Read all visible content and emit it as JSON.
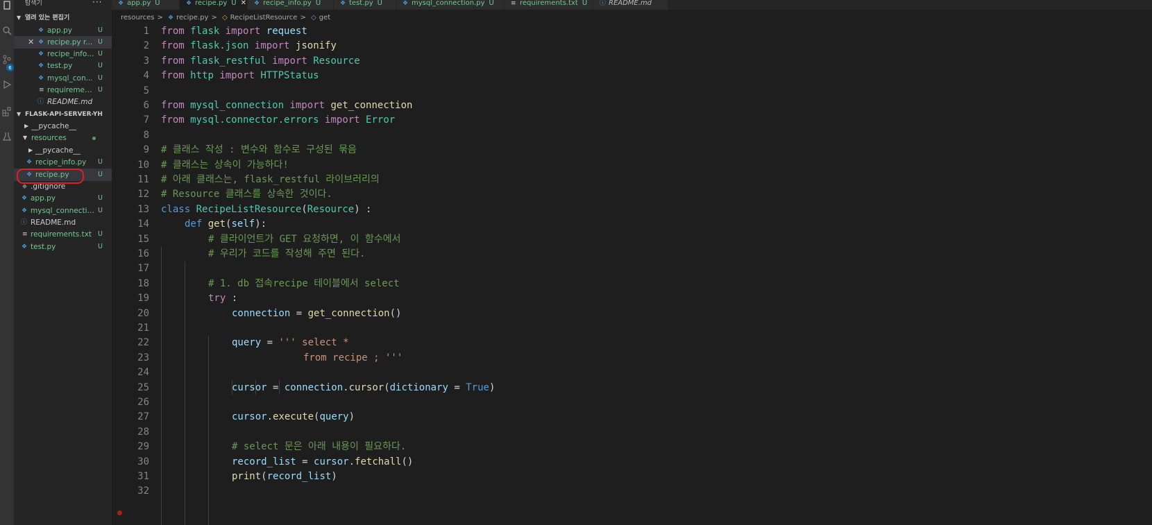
{
  "sidebar": {
    "title": "탐색기",
    "more": "···",
    "open_editors": {
      "header": "열려 있는 편집기",
      "items": [
        {
          "label": "app.py",
          "badge": "U"
        },
        {
          "label": "recipe.py r...",
          "badge": "U",
          "close": "✕"
        },
        {
          "label": "recipe_info....",
          "badge": "U"
        },
        {
          "label": "test.py",
          "badge": "U"
        },
        {
          "label": "mysql_con...",
          "badge": "U"
        },
        {
          "label": "requiremen...",
          "badge": "U"
        },
        {
          "label": "README.md",
          "badge": ""
        }
      ]
    },
    "workspace": {
      "header": "FLASK-API-SERVER-YH",
      "items": [
        {
          "label": "__pycache__",
          "badge": ""
        },
        {
          "label": "resources",
          "badge": ""
        },
        {
          "label": "__pycache__",
          "badge": ""
        },
        {
          "label": "recipe_info.py",
          "badge": "U"
        },
        {
          "label": "recipe.py",
          "badge": "U"
        },
        {
          "label": ".gitignore",
          "badge": ""
        },
        {
          "label": "app.py",
          "badge": "U"
        },
        {
          "label": "mysql_connectio...",
          "badge": "U"
        },
        {
          "label": "README.md",
          "badge": ""
        },
        {
          "label": "requirements.txt",
          "badge": "U"
        },
        {
          "label": "test.py",
          "badge": "U"
        }
      ]
    }
  },
  "activity": {
    "scm_badge": "6"
  },
  "tabs": [
    {
      "label": "app.py",
      "badge": "U"
    },
    {
      "label": "recipe.py",
      "badge": "U",
      "close": "✕"
    },
    {
      "label": "recipe_info.py",
      "badge": "U"
    },
    {
      "label": "test.py",
      "badge": "U"
    },
    {
      "label": "mysql_connection.py",
      "badge": "U"
    },
    {
      "label": "requirements.txt",
      "badge": "U"
    },
    {
      "label": "README.md",
      "badge": ""
    }
  ],
  "breadcrumb": {
    "folder": "resources",
    "file": "recipe.py",
    "class": "RecipeListResource",
    "method": "get",
    "sep": ">"
  },
  "code": {
    "line_numbers": [
      "1",
      "2",
      "3",
      "4",
      "5",
      "6",
      "7",
      "8",
      "9",
      "10",
      "11",
      "12",
      "13",
      "14",
      "15",
      "16",
      "17",
      "18",
      "19",
      "20",
      "21",
      "22",
      "23",
      "24",
      "25",
      "26",
      "27",
      "28",
      "29",
      "30",
      "31",
      "32"
    ],
    "l1": [
      "from",
      "flask",
      "import",
      "request"
    ],
    "l2": [
      "from",
      "flask.json",
      "import",
      "jsonify"
    ],
    "l3": [
      "from",
      "flask_restful",
      "import",
      "Resource"
    ],
    "l4": [
      "from",
      "http",
      "import",
      "HTTPStatus"
    ],
    "l6": [
      "from",
      "mysql_connection",
      "import",
      "get_connection"
    ],
    "l7": [
      "from",
      "mysql.connector.errors",
      "import",
      "Error"
    ],
    "l9": "# 클래스 작성 : 변수와 함수로 구성된 묶음",
    "l10": "# 클래스는 상속이 가능하다!",
    "l11": "# 아래 클래스는, flask_restful 라이브러리의",
    "l12": "# Resource 클래스를 상속한 것이다.",
    "l13": [
      "class",
      "RecipeListResource",
      "(",
      "Resource",
      ") :"
    ],
    "l14": [
      "def",
      "get",
      "(",
      "self",
      "):"
    ],
    "l15": "# 클라이언트가 GET 요청하면, 이 함수에서",
    "l16": "# 우리가 코드를 작성해 주면 된다.",
    "l18": "# 1. db 접속recipe 테이블에서 select",
    "l19": [
      "try",
      " :"
    ],
    "l20": [
      "connection",
      " = ",
      "get_connection",
      "()"
    ],
    "l22": [
      "query",
      " = ",
      "''' select *"
    ],
    "l23": "from recipe ; '''",
    "l25": [
      "cursor",
      " = ",
      "connection",
      ".",
      "cursor",
      "(",
      "dictionary",
      " = ",
      "True",
      ")"
    ],
    "l27": [
      "cursor",
      ".",
      "execute",
      "(",
      "query",
      ")"
    ],
    "l29": "# select 문은 아래 내용이 필요하다.",
    "l30": [
      "record_list",
      " = ",
      "cursor",
      ".",
      "fetchall",
      "()"
    ],
    "l31": [
      "print",
      "(",
      "record_list",
      ")"
    ]
  }
}
